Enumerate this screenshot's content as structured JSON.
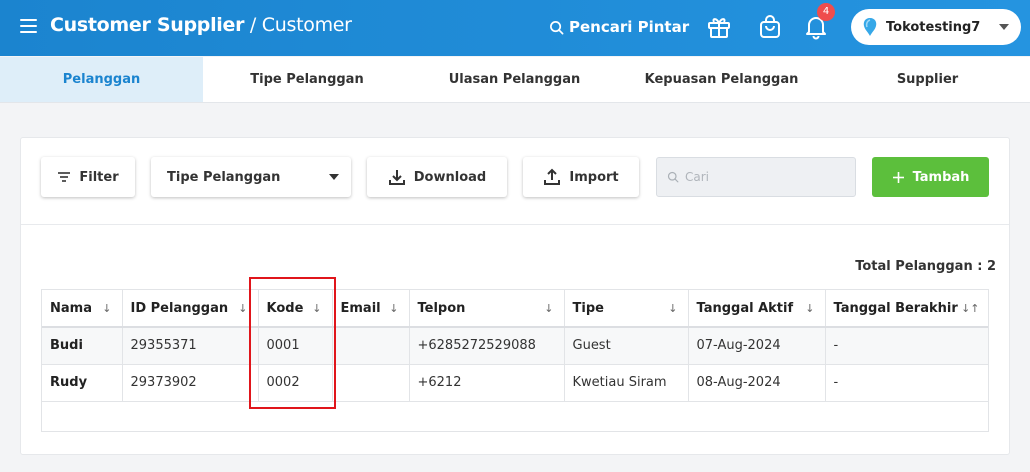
{
  "header": {
    "title_main": "Customer Supplier",
    "title_separator": " / ",
    "title_sub": "Customer",
    "smart_search_label": "Pencari Pintar",
    "notification_count": "4",
    "store_name": "Tokotesting7",
    "icons": [
      "menu-icon",
      "search-icon",
      "gift-icon",
      "shopping-bag-icon",
      "bell-icon",
      "store-logo-icon",
      "chevron-down-icon"
    ]
  },
  "tabs": [
    {
      "label": "Pelanggan",
      "active": true
    },
    {
      "label": "Tipe Pelanggan",
      "active": false
    },
    {
      "label": "Ulasan Pelanggan",
      "active": false
    },
    {
      "label": "Kepuasan Pelanggan",
      "active": false
    },
    {
      "label": "Supplier",
      "active": false
    }
  ],
  "toolbar": {
    "filter_label": "Filter",
    "customer_type_select": "Tipe Pelanggan",
    "download_label": "Download",
    "import_label": "Import",
    "search_placeholder": "Cari",
    "add_label": "Tambah"
  },
  "summary": {
    "total_label": "Total Pelanggan : 2"
  },
  "table": {
    "columns": [
      "Nama",
      "ID Pelanggan",
      "Kode",
      "Email",
      "Telpon",
      "Tipe",
      "Tanggal Aktif",
      "Tanggal Berakhir"
    ],
    "rows": [
      {
        "name": "Budi",
        "id": "29355371",
        "code": "0001",
        "email": "",
        "phone": "+6285272529088",
        "type": "Guest",
        "active_date": "07-Aug-2024",
        "end_date": "-"
      },
      {
        "name": "Rudy",
        "id": "29373902",
        "code": "0002",
        "email": "",
        "phone": "+6212",
        "type": "Kwetiau Siram",
        "active_date": "08-Aug-2024",
        "end_date": "-"
      }
    ]
  },
  "colors": {
    "header_blue": "#1b84cf",
    "add_green": "#5cbf3c",
    "badge_red": "#ef4d4d",
    "highlight_red": "#e0151b"
  }
}
